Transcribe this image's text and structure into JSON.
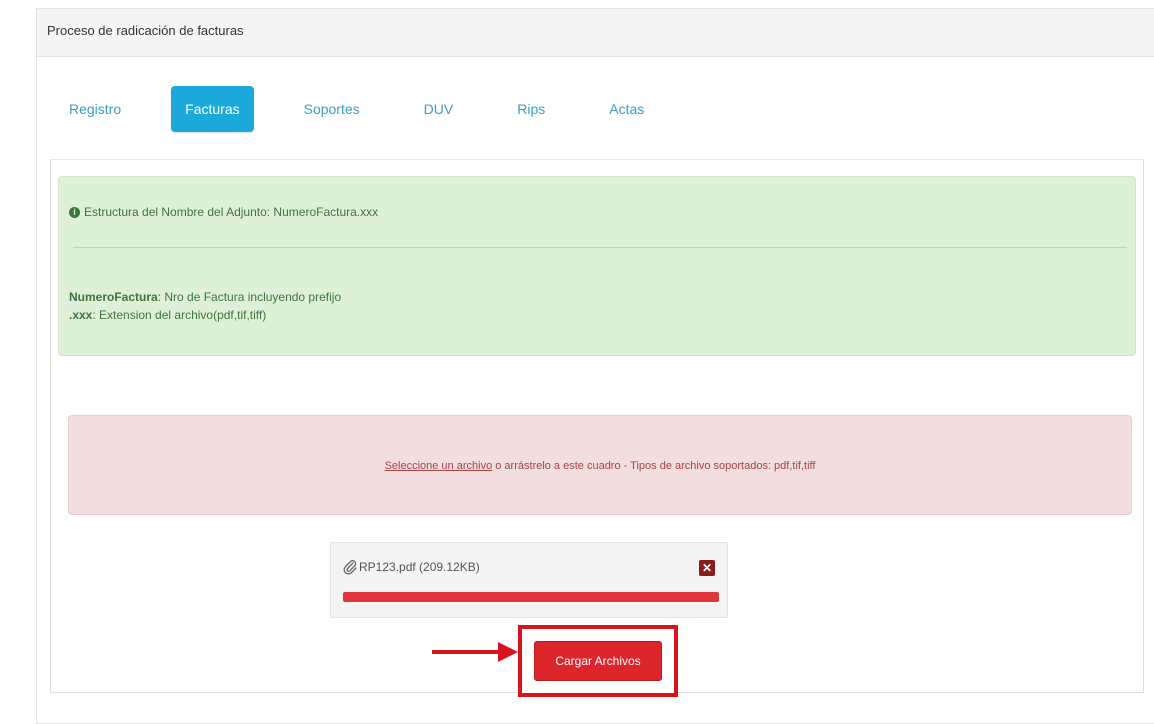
{
  "header": {
    "title": "Proceso de radicación de facturas"
  },
  "tabs": [
    {
      "label": "Registro",
      "active": false
    },
    {
      "label": "Facturas",
      "active": true
    },
    {
      "label": "Soportes",
      "active": false
    },
    {
      "label": "DUV",
      "active": false
    },
    {
      "label": "Rips",
      "active": false
    },
    {
      "label": "Actas",
      "active": false
    }
  ],
  "info": {
    "title": "Estructura del Nombre del Adjunto: NumeroFactura.xxx",
    "line1_key": "NumeroFactura",
    "line1_text": ": Nro de Factura incluyendo prefijo",
    "line2_key": ".xxx",
    "line2_text": ": Extension del archivo(pdf,tif,tiff)"
  },
  "dropzone": {
    "link_text": "Seleccione un archivo",
    "text": " o arrástrelo a este cuadro - Tipos de archivo soportados: pdf,tif,tiff"
  },
  "file": {
    "name": "RP123.pdf (209.12KB)",
    "progress_percent": 100
  },
  "upload_button": {
    "label": "Cargar Archivos"
  },
  "colors": {
    "accent": "#1ba9dc",
    "success_bg": "#dff0d8",
    "danger_bg": "#f2dede",
    "button_red": "#dd262c",
    "highlight_red": "#d7141e"
  },
  "icons": {
    "info": "info-circle-icon",
    "attachment": "paperclip-icon",
    "remove": "close-box-icon",
    "arrow": "arrow-right-icon"
  }
}
